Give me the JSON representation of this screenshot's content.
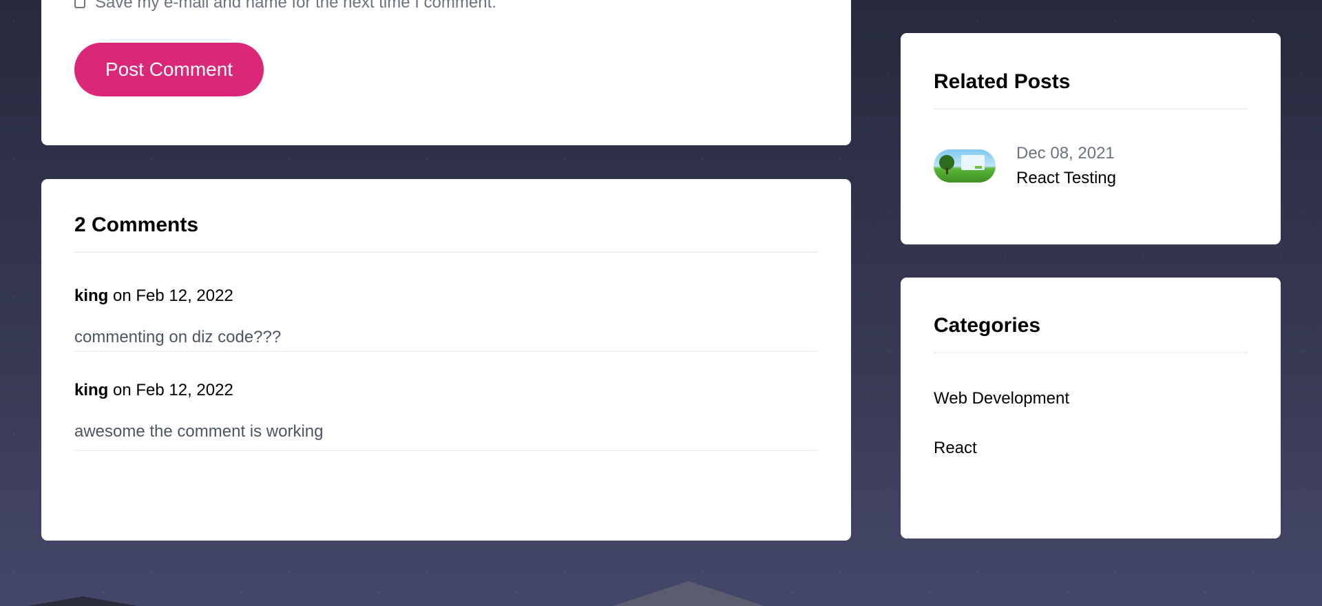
{
  "form": {
    "checkbox_label": "Save my e-mail and name for the next time I comment.",
    "submit_label": "Post Comment"
  },
  "comments": {
    "title": "2 Comments",
    "items": [
      {
        "author": "king",
        "meta": " on Feb 12, 2022",
        "text": "commenting on diz code???"
      },
      {
        "author": "king",
        "meta": " on Feb 12, 2022",
        "text": "awesome the comment is working"
      }
    ]
  },
  "related": {
    "title": "Related Posts",
    "items": [
      {
        "date": "Dec 08, 2021",
        "title": "React Testing"
      }
    ]
  },
  "categories": {
    "title": "Categories",
    "items": [
      "Web Development",
      "React"
    ]
  },
  "colors": {
    "accent": "#db2777",
    "background": "#30334a"
  }
}
